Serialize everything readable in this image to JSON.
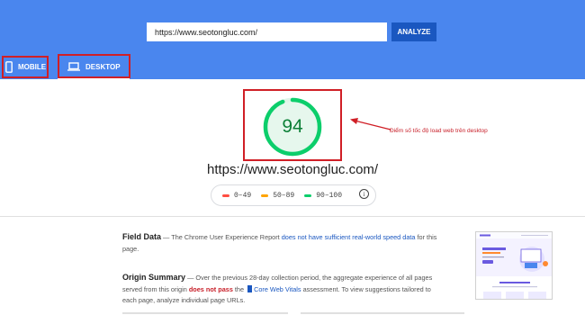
{
  "search": {
    "url_value": "https://www.seotongluc.com/",
    "analyze_label": "ANALYZE"
  },
  "tabs": [
    {
      "label": "MOBILE"
    },
    {
      "label": "DESKTOP"
    }
  ],
  "score": {
    "value": "94",
    "fraction": 0.94,
    "color": "#0cce6b"
  },
  "annotation": {
    "text": "Điểm số tốc độ load web trên desktop"
  },
  "tested_url": "https://www.seotongluc.com/",
  "legend": [
    {
      "label": "0–49",
      "color": "#ff4e42"
    },
    {
      "label": "50–89",
      "color": "#ffa400"
    },
    {
      "label": "90–100",
      "color": "#0cce6b"
    }
  ],
  "field_data": {
    "title": "Field Data",
    "separator": "—",
    "text_before": "The Chrome User Experience Report",
    "link": "does not have sufficient real-world speed data",
    "text_after": "for this page."
  },
  "origin_summary": {
    "title": "Origin Summary",
    "separator": "—",
    "text_before": "Over the previous 28-day collection period, the aggregate experience of all pages served from this origin",
    "status": "does not pass",
    "text_mid": "the",
    "cwv_link": "Core Web Vitals",
    "text_after": "assessment. To view suggestions tailored to each page, analyze individual page URLs."
  },
  "colors": {
    "header_blue": "#4a86ee",
    "button_blue": "#1a57c0",
    "highlight_red": "#d01f26",
    "pass_green": "#0cce6b"
  }
}
